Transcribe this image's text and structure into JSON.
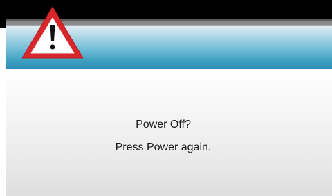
{
  "dialog": {
    "icon": "warning-icon",
    "message_line_1": "Power Off?",
    "message_line_2": "Press Power again."
  },
  "colors": {
    "header_blue": "#3d9fc2",
    "warning_red": "#d9262b",
    "warning_fill": "#ffffff",
    "top_bar": "#000000"
  }
}
